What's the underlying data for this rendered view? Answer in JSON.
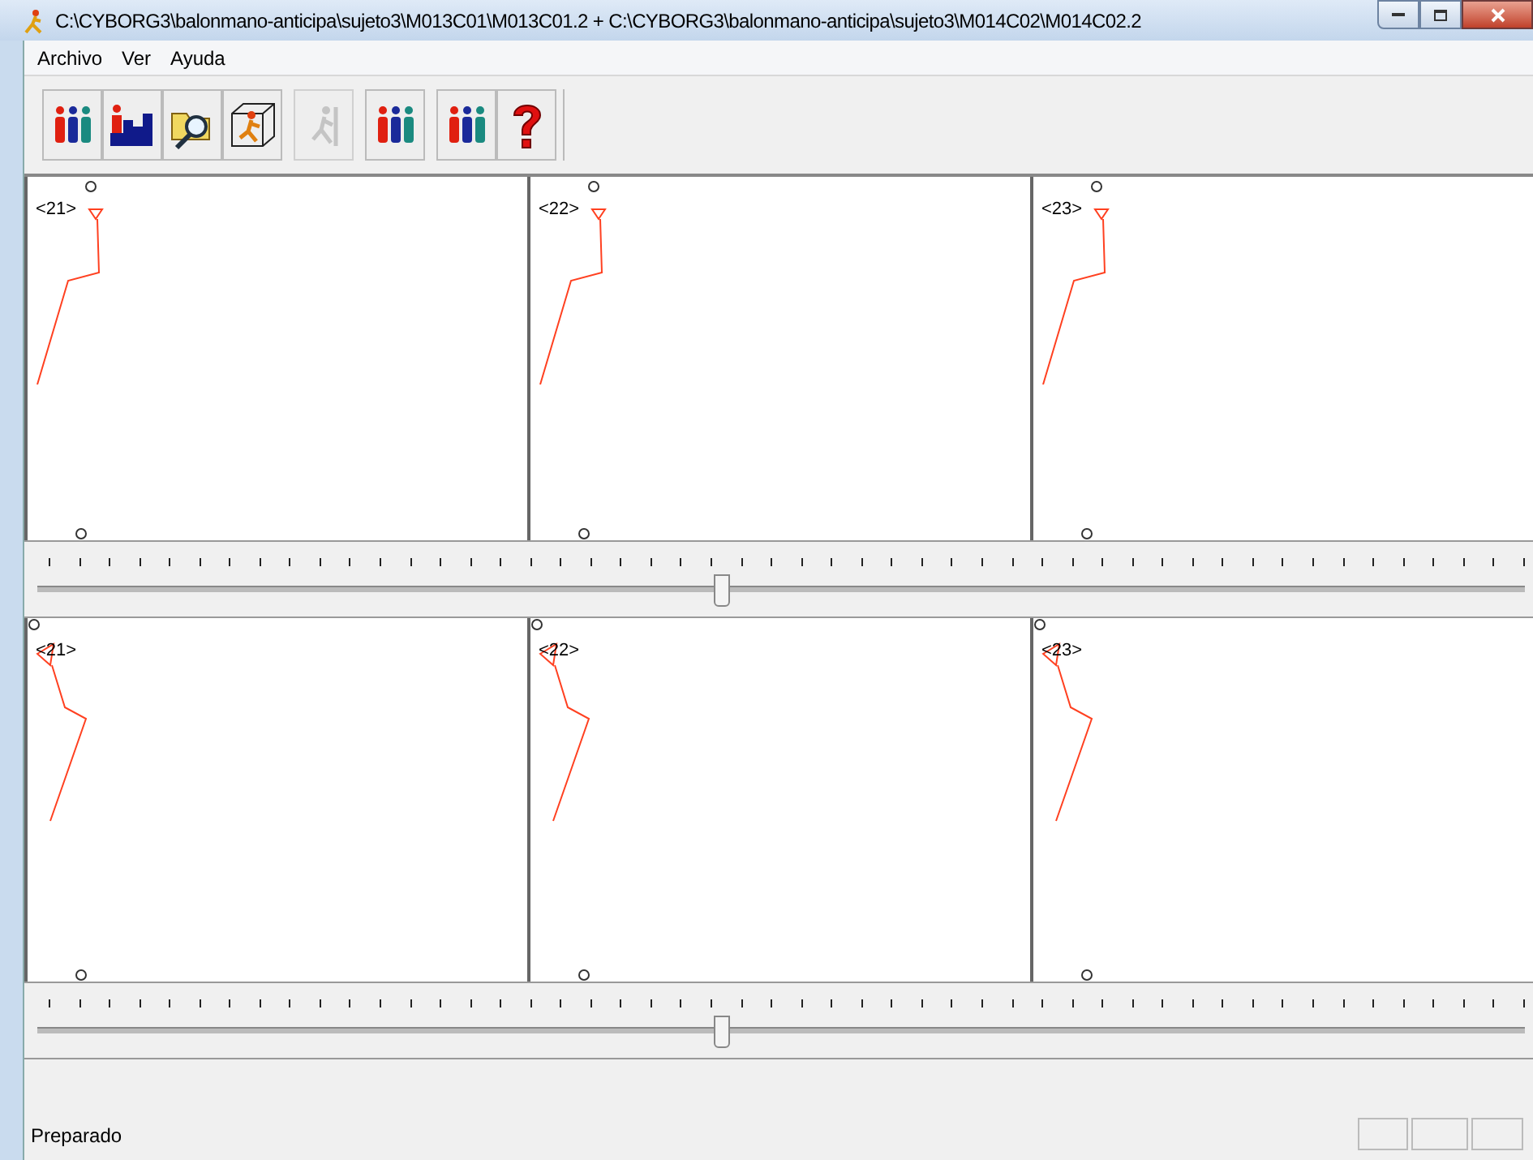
{
  "window": {
    "title": "C:\\CYBORG3\\balonmano-anticipa\\sujeto3\\M013C01\\M013C01.2 + C:\\CYBORG3\\balonmano-anticipa\\sujeto3\\M014C02\\M014C02.2"
  },
  "menu": [
    "Archivo",
    "Ver",
    "Ayuda"
  ],
  "toolbar": [
    {
      "kind": "people",
      "disabled": false
    },
    {
      "kind": "chart",
      "disabled": false
    },
    {
      "kind": "open",
      "disabled": false
    },
    {
      "kind": "cube",
      "disabled": false
    },
    {
      "kind": "runner",
      "disabled": true
    },
    {
      "kind": "people",
      "disabled": false
    },
    {
      "kind": "people",
      "disabled": false
    },
    {
      "kind": "help",
      "disabled": false
    }
  ],
  "views": [
    {
      "panels": [
        {
          "label": "<21>"
        },
        {
          "label": "<22>"
        },
        {
          "label": "<23>"
        }
      ],
      "slider": {
        "level": 0.46
      }
    },
    {
      "panels": [
        {
          "label": "<21>"
        },
        {
          "label": "<22>"
        },
        {
          "label": "<23>"
        }
      ],
      "slider": {
        "level": 0.46
      }
    }
  ],
  "status_bar": {
    "text": "Preparado"
  }
}
